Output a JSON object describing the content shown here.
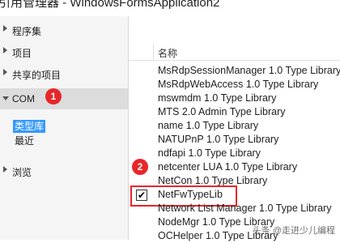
{
  "window": {
    "title": "引用管理器 - WindowsFormsApplication2"
  },
  "sidebar": {
    "items": [
      {
        "label": "程序集"
      },
      {
        "label": "项目"
      },
      {
        "label": "共享的项目"
      },
      {
        "label": "COM"
      },
      {
        "label": "浏览"
      }
    ],
    "com_subitems": [
      {
        "label": "类型库"
      },
      {
        "label": "最近"
      }
    ]
  },
  "annotations": {
    "badge1": "1",
    "badge2": "2"
  },
  "list": {
    "column_header": "名称",
    "rows": [
      {
        "name": "MsRdpSessionManager 1.0 Type Library",
        "checked": false
      },
      {
        "name": "MsRdpWebAccess 1.0 Type Library",
        "checked": false
      },
      {
        "name": "mswmdm 1.0 Type Library",
        "checked": false
      },
      {
        "name": "MTS 2.0 Admin Type Library",
        "checked": false
      },
      {
        "name": "name 1.0 Type Library",
        "checked": false
      },
      {
        "name": "NATUPnP 1.0 Type Library",
        "checked": false
      },
      {
        "name": "ndfapi 1.0 Type Library",
        "checked": false
      },
      {
        "name": "netcenter LUA 1.0 Type Library",
        "checked": false
      },
      {
        "name": "NetCon 1.0 Type Library",
        "checked": false
      },
      {
        "name": "NetFwTypeLib",
        "checked": true
      },
      {
        "name": "Network List Manager 1.0 Type Library",
        "checked": false
      },
      {
        "name": "NodeMgr 1.0 Type Library",
        "checked": false
      },
      {
        "name": "OCHelper 1.0 Type Library",
        "checked": false
      }
    ],
    "checkmark": "✔"
  },
  "watermark": "头条 @走进少儿编程",
  "colors": {
    "selected_bg": "#3399ff",
    "badge": "#e8262a",
    "sidebar_bg": "#f5f5f5"
  }
}
